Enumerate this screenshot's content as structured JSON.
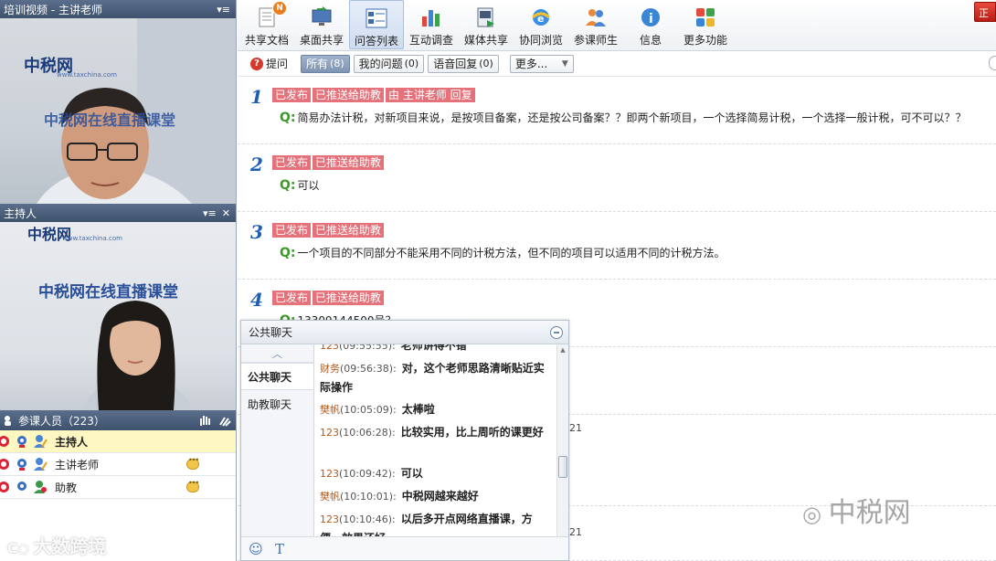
{
  "video_panel": {
    "title": "培训视频 - 主讲老师",
    "ctrl_glyph": "▾≡",
    "logo": "中税网",
    "logo_url": "www.taxchina.com",
    "banner": "中税网在线直播课堂"
  },
  "host_panel": {
    "title": "主持人",
    "ctrl_glyph": "▾≡",
    "close_glyph": "✕",
    "logo": "中税网",
    "logo_url": "www.taxchina.com",
    "banner": "中税网在线直播课堂"
  },
  "participants": {
    "title": "参课人员（223）",
    "rows": [
      {
        "name": "主持人",
        "selected": true
      },
      {
        "name": "主讲老师",
        "selected": false
      },
      {
        "name": "助教",
        "selected": false
      }
    ]
  },
  "toolbar": {
    "items": [
      {
        "label": "共享文档",
        "icon": "document-icon",
        "badge": "N"
      },
      {
        "label": "桌面共享",
        "icon": "desktop-share-icon"
      },
      {
        "label": "问答列表",
        "icon": "qa-list-icon",
        "active": true
      },
      {
        "label": "互动调查",
        "icon": "survey-chart-icon"
      },
      {
        "label": "媒体共享",
        "icon": "media-share-icon"
      },
      {
        "label": "协同浏览",
        "icon": "browser-icon"
      },
      {
        "label": "参课师生",
        "icon": "people-icon"
      },
      {
        "label": "信息",
        "icon": "info-icon"
      },
      {
        "label": "更多功能",
        "icon": "more-grid-icon"
      }
    ],
    "corner_button": "正"
  },
  "filters": {
    "ask": "提问",
    "all": "所有",
    "all_count": "(8)",
    "mine": "我的问题",
    "mine_count": "(0)",
    "voice": "语音回复",
    "voice_count": "(0)",
    "more": "更多..."
  },
  "questions": [
    {
      "num": "1",
      "tags": [
        "已发布",
        "已推送给助教",
        "由 主讲老师 回复"
      ],
      "q_mark": "Q:",
      "text": "简易办法计税，对新项目来说，是按项目备案，还是按公司备案？？即两个新项目，一个选择简易计税，一个选择一般计税，可不可以？？"
    },
    {
      "num": "2",
      "tags": [
        "已发布",
        "已推送给助教"
      ],
      "q_mark": "Q:",
      "text": "可以"
    },
    {
      "num": "3",
      "tags": [
        "已发布",
        "已推送给助教"
      ],
      "q_mark": "Q:",
      "text": "一个项目的不同部分不能采用不同的计税方法，但不同的项目可以适用不同的计税方法。"
    },
    {
      "num": "4",
      "tags": [
        "已发布",
        "已推送给助教"
      ],
      "q_mark": "Q:",
      "text": "13309144500号？"
    }
  ],
  "peeks": [
    "21",
    "21"
  ],
  "chat": {
    "title": "公共聊天",
    "up_glyph": "︿",
    "tabs": [
      "公共聊天",
      "助教聊天"
    ],
    "messages": [
      {
        "nick": "123",
        "time": "(09:55:55):",
        "text": "老师讲得不错"
      },
      {
        "nick": "财务",
        "time": "(09:56:38):",
        "text": "对，这个老师思路清晰贴近实际操作"
      },
      {
        "nick": "樊帆",
        "time": "(10:05:09):",
        "text": "太棒啦"
      },
      {
        "nick": "123",
        "time": "(10:06:28):",
        "text": "比较实用，比上周听的课更好"
      },
      {
        "nick": "123",
        "time": "(10:09:42):",
        "text": "可以"
      },
      {
        "nick": "樊帆",
        "time": "(10:10:01):",
        "text": "中税网越来越好"
      },
      {
        "nick": "123",
        "time": "(10:10:46):",
        "text": "以后多开点网络直播课，方便，效果还好"
      }
    ],
    "footer": {
      "emoji": "☺",
      "font": "T"
    }
  },
  "watermarks": {
    "left": "大数跨境",
    "right": "中税网"
  },
  "colors": {
    "tag_bg": "#e5727a",
    "number_blue": "#1e5fb5",
    "q_green": "#3d9a2a",
    "header_bar": "#4a5d7a",
    "highlight_row": "#fff7c2"
  }
}
